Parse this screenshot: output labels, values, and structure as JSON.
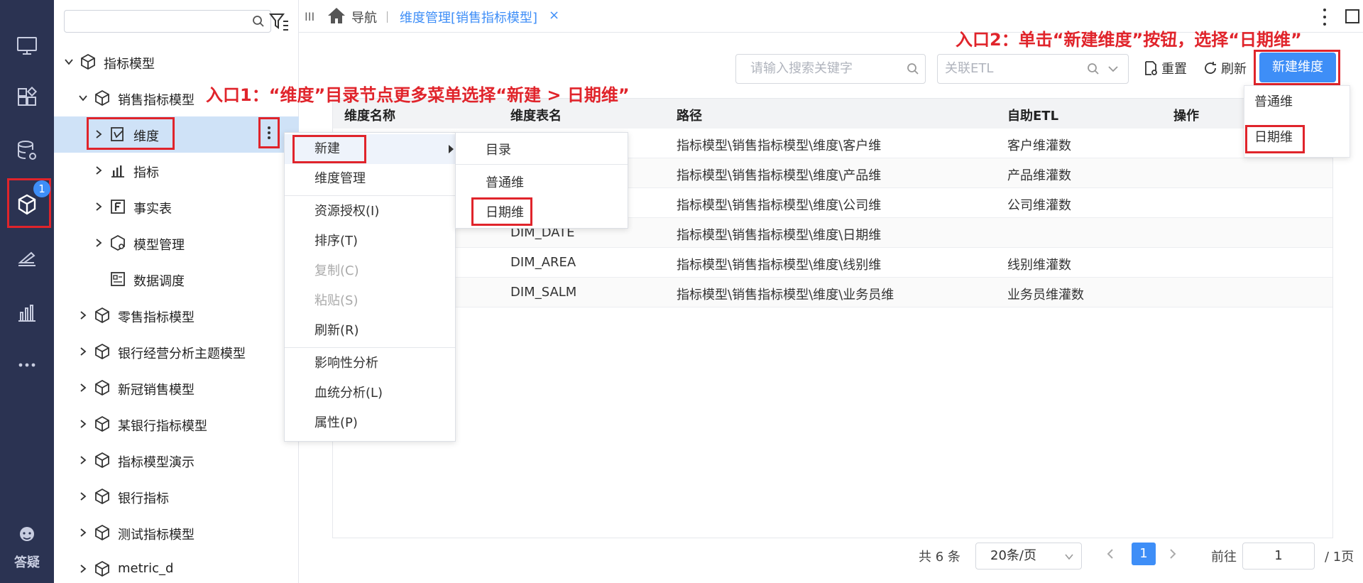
{
  "rail": {
    "badge": "1",
    "help_label": "答疑",
    "icons": [
      "monitor-icon",
      "apps-icon",
      "database-gear-icon",
      "cube-model-icon",
      "ruler-tools-icon",
      "bar-chart-icon",
      "more-icon",
      "help-icon"
    ]
  },
  "tree": {
    "search_value": "",
    "items": [
      {
        "label": "指标模型",
        "level": 0,
        "expanded": true
      },
      {
        "label": "销售指标模型",
        "level": 1,
        "expanded": true
      },
      {
        "label": "维度",
        "level": 2,
        "selected": true
      },
      {
        "label": "指标",
        "level": 2
      },
      {
        "label": "事实表",
        "level": 2
      },
      {
        "label": "模型管理",
        "level": 2
      },
      {
        "label": "数据调度",
        "level": 2
      },
      {
        "label": "零售指标模型",
        "level": 1
      },
      {
        "label": "银行经营分析主题模型",
        "level": 1
      },
      {
        "label": "新冠销售模型",
        "level": 1
      },
      {
        "label": "某银行指标模型",
        "level": 1
      },
      {
        "label": "指标模型演示",
        "level": 1
      },
      {
        "label": "银行指标",
        "level": 1
      },
      {
        "label": "测试指标模型",
        "level": 1
      },
      {
        "label": "metric_d",
        "level": 1
      }
    ]
  },
  "tabbar": {
    "collapse_label": "III",
    "nav_label": "导航",
    "active_tab": "维度管理[销售指标模型]",
    "close_label": "×"
  },
  "toolbar": {
    "search_placeholder": "请输入搜索关键字",
    "etl_placeholder": "关联ETL",
    "reset_label": "重置",
    "refresh_label": "刷新",
    "new_dimension_label": "新建维度"
  },
  "dropdown": {
    "items": [
      "普通维",
      "日期维"
    ]
  },
  "table": {
    "headers": [
      "维度名称",
      "维度表名",
      "路径",
      "自助ETL",
      "操作"
    ],
    "rows": [
      {
        "name": "",
        "table": "",
        "path": "指标模型\\销售指标模型\\维度\\客户维",
        "etl": "客户维灌数"
      },
      {
        "name": "",
        "table": "",
        "path": "指标模型\\销售指标模型\\维度\\产品维",
        "etl": "产品维灌数"
      },
      {
        "name": "",
        "table": "",
        "path": "指标模型\\销售指标模型\\维度\\公司维",
        "etl": "公司维灌数"
      },
      {
        "name": "",
        "table": "DIM_DATE",
        "path": "指标模型\\销售指标模型\\维度\\日期维",
        "etl": ""
      },
      {
        "name": "",
        "table": "DIM_AREA",
        "path": "指标模型\\销售指标模型\\维度\\线别维",
        "etl": "线别维灌数"
      },
      {
        "name": "",
        "table": "DIM_SALM",
        "path": "指标模型\\销售指标模型\\维度\\业务员维",
        "etl": "业务员维灌数"
      }
    ]
  },
  "context_menu": {
    "items": [
      "新建",
      "维度管理",
      "资源授权(I)",
      "排序(T)",
      "复制(C)",
      "粘贴(S)",
      "刷新(R)",
      "影响性分析",
      "血统分析(L)",
      "属性(P)"
    ],
    "submenu": [
      "目录",
      "普通维",
      "日期维"
    ]
  },
  "annotations": {
    "entry1": "入口1：“维度”目录节点更多菜单选择“新建 > 日期维”",
    "entry2": "入口2：单击“新建维度”按钮，选择“日期维”"
  },
  "pagination": {
    "total": "共 6 条",
    "page_size": "20条/页",
    "current": "1",
    "goto_label": "前往",
    "goto_value": "1",
    "pages": "/ 1页"
  },
  "colors": {
    "rail_bg": "#2b3352",
    "accent": "#3e8ef7",
    "annotation": "#e0242b",
    "selected_row": "#cfe2f7"
  }
}
